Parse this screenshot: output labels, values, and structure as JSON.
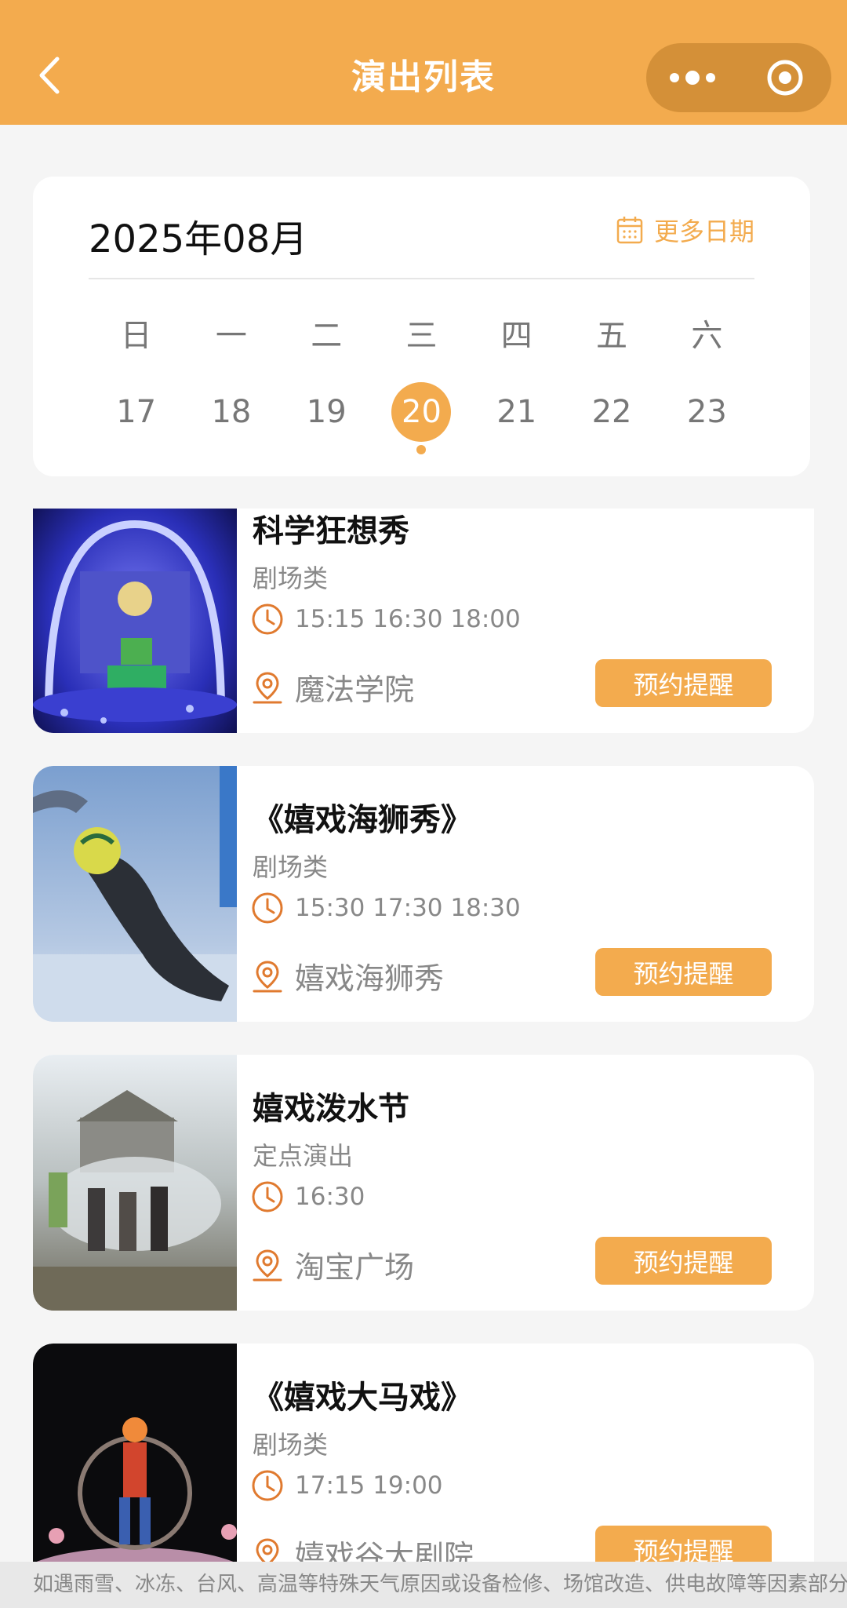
{
  "header": {
    "title": "演出列表"
  },
  "calendar": {
    "month": "2025年08月",
    "more_dates": "更多日期",
    "weekdays": [
      "日",
      "一",
      "二",
      "三",
      "四",
      "五",
      "六"
    ],
    "dates": [
      "17",
      "18",
      "19",
      "20",
      "21",
      "22",
      "23"
    ],
    "selected": "20"
  },
  "shows": [
    {
      "title": "科学狂想秀",
      "category": "剧场类",
      "times": "15:15 16:30 18:00",
      "location": "魔法学院",
      "button": "预约提醒"
    },
    {
      "title": "《嬉戏海狮秀》",
      "category": "剧场类",
      "times": "15:30 17:30 18:30",
      "location": "嬉戏海狮秀",
      "button": "预约提醒"
    },
    {
      "title": "嬉戏泼水节",
      "category": "定点演出",
      "times": "16:30",
      "location": "淘宝广场",
      "button": "预约提醒"
    },
    {
      "title": "《嬉戏大马戏》",
      "category": "剧场类",
      "times": "17:15 19:00",
      "location": "嬉戏谷大剧院",
      "button": "预约提醒"
    }
  ],
  "notice": "如遇雨雪、冰冻、台风、高温等特殊天气原因或设备检修、场馆改造、供电故障等因素部分",
  "colors": {
    "accent": "#f3ab4e",
    "text_muted": "#888888",
    "background": "#f5f5f5"
  },
  "icons": {
    "back": "chevron-left-icon",
    "more": "more-dots-icon",
    "close": "target-circle-icon",
    "calendar": "calendar-icon",
    "clock": "clock-icon",
    "location": "location-pin-icon"
  }
}
